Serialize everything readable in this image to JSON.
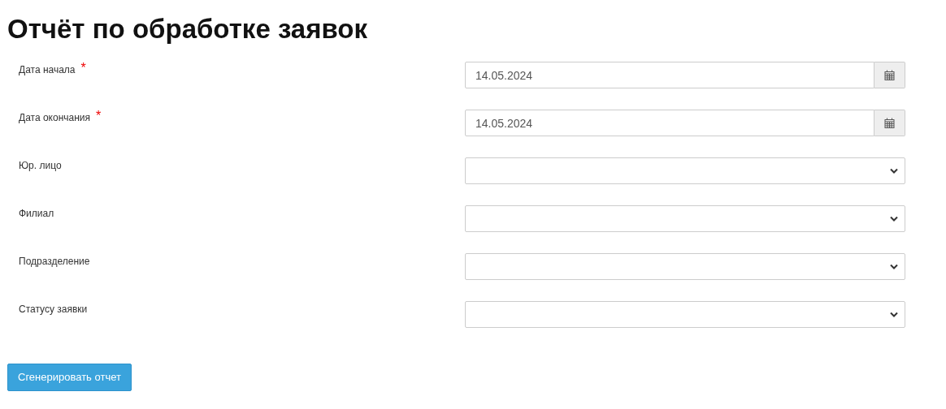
{
  "title": "Отчёт по обработке заявок",
  "fields": [
    {
      "label": "Дата начала",
      "required": true,
      "kind": "date",
      "value": "14.05.2024"
    },
    {
      "label": "Дата окончания",
      "required": true,
      "kind": "date",
      "value": "14.05.2024"
    },
    {
      "label": "Юр. лицо",
      "required": false,
      "kind": "select"
    },
    {
      "label": "Филиал",
      "required": false,
      "kind": "select"
    },
    {
      "label": "Подразделение",
      "required": false,
      "kind": "select"
    },
    {
      "label": "Статусу заявки",
      "required": false,
      "kind": "select"
    }
  ],
  "required_mark": "*",
  "submit": "Сгенерировать отчет"
}
